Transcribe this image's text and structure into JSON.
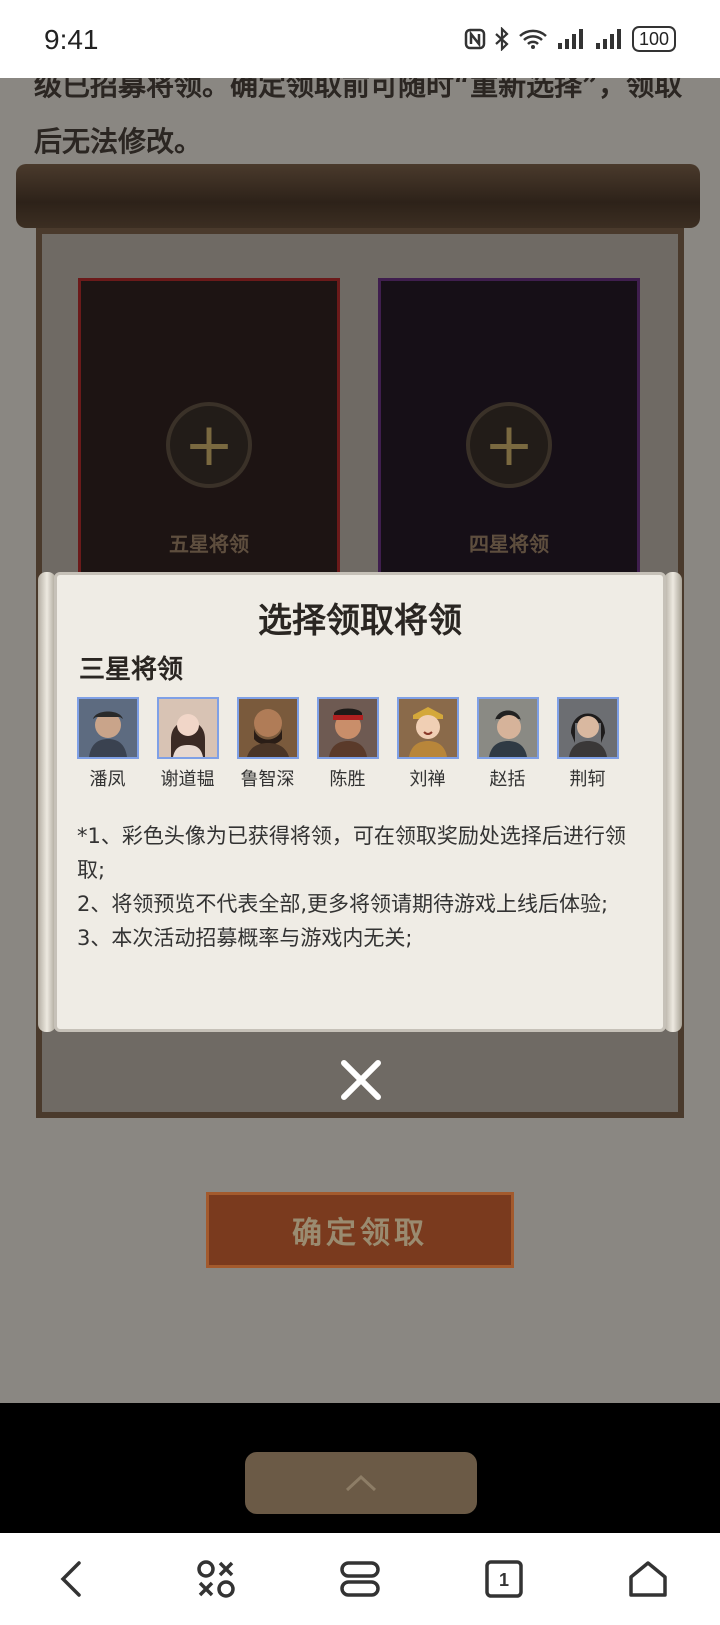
{
  "status_bar": {
    "time": "9:41",
    "battery": "100",
    "icons": [
      "nfc-icon",
      "bluetooth-icon",
      "wifi-icon",
      "signal-icon",
      "signal-icon",
      "battery-icon"
    ]
  },
  "background_page": {
    "intro_text": "级已招募将领。确定领取前可随时“重新选择”，领取后无法修改。",
    "slots": [
      {
        "label": "五星将领"
      },
      {
        "label": "四星将领"
      }
    ],
    "confirm_button": "确定领取"
  },
  "modal": {
    "title": "选择领取将领",
    "section_title": "三星将领",
    "generals": [
      {
        "name": "潘凤"
      },
      {
        "name": "谢道韫"
      },
      {
        "name": "鲁智深"
      },
      {
        "name": "陈胜"
      },
      {
        "name": "刘禅"
      },
      {
        "name": "赵括"
      },
      {
        "name": "荆轲"
      }
    ],
    "notes": [
      "*1、彩色头像为已获得将领，可在领取奖励处选择后进行领取;",
      "2、将领预览不代表全部,更多将领请期待游戏上线后体验;",
      "3、本次活动招募概率与游戏内无关;"
    ]
  },
  "bottom_nav": {
    "items": [
      "back-icon",
      "apps-icon",
      "menu-icon",
      "tabs-icon",
      "home-icon"
    ],
    "tab_count": "1"
  }
}
